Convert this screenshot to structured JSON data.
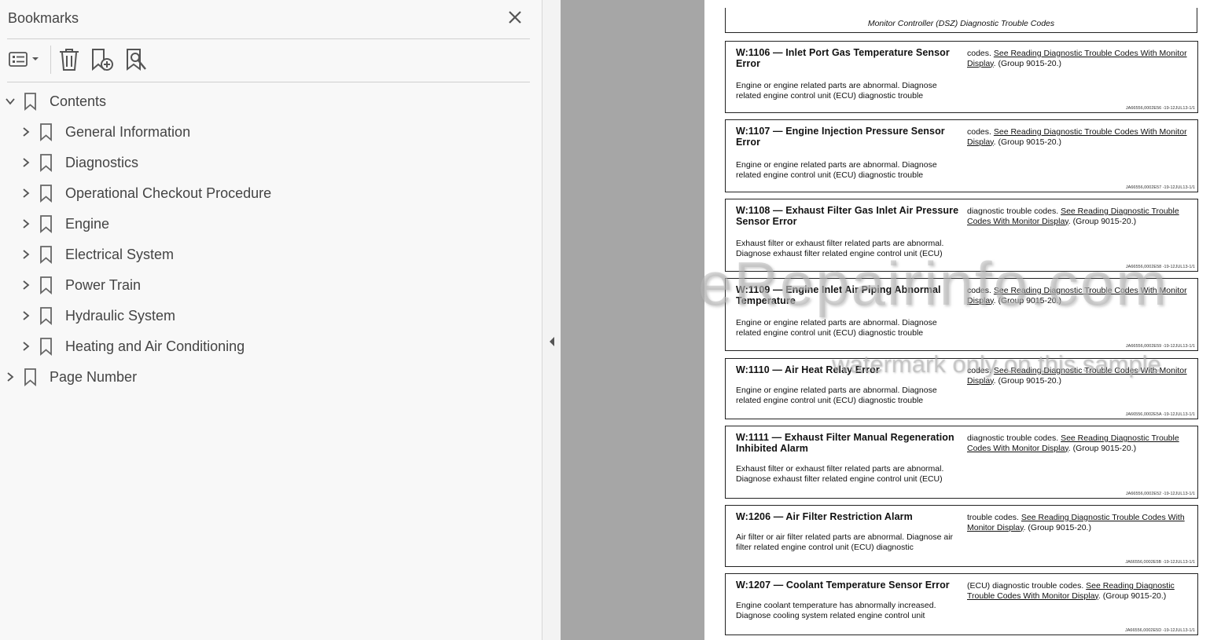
{
  "bookmarks_panel": {
    "title": "Bookmarks",
    "items": [
      {
        "label": "Contents",
        "level": 0,
        "expanded": true
      },
      {
        "label": "General Information",
        "level": 1,
        "expanded": false
      },
      {
        "label": "Diagnostics",
        "level": 1,
        "expanded": false
      },
      {
        "label": "Operational Checkout Procedure",
        "level": 1,
        "expanded": false
      },
      {
        "label": "Engine",
        "level": 1,
        "expanded": false
      },
      {
        "label": "Electrical System",
        "level": 1,
        "expanded": false
      },
      {
        "label": "Power Train",
        "level": 1,
        "expanded": false
      },
      {
        "label": "Hydraulic System",
        "level": 1,
        "expanded": false
      },
      {
        "label": "Heating and Air Conditioning",
        "level": 1,
        "expanded": false
      },
      {
        "label": "Page Number",
        "level": 0,
        "expanded": false
      }
    ]
  },
  "document": {
    "header": "Monitor Controller (DSZ) Diagnostic Trouble Codes",
    "entries": [
      {
        "title": "W:1106 — Inlet Port Gas Temperature Sensor Error",
        "desc": "Engine or engine related parts are abnormal. Diagnose related engine control unit (ECU) diagnostic trouble",
        "right_pre": "codes. ",
        "link": "See Reading Diagnostic Trouble Codes With Monitor Display",
        "right_post": ". (Group 9015-20.)",
        "ref": "JA66556,0002E56 -19-12JUL13-1/1"
      },
      {
        "title": "W:1107 — Engine Injection Pressure Sensor Error",
        "desc": "Engine or engine related parts are abnormal. Diagnose related engine control unit (ECU) diagnostic trouble",
        "right_pre": "codes. ",
        "link": "See Reading Diagnostic Trouble Codes With Monitor Display",
        "right_post": ". (Group 9015-20.)",
        "ref": "JA66556,0002E57 -19-12JUL13-1/1"
      },
      {
        "title": "W:1108 — Exhaust Filter Gas Inlet Air Pressure Sensor Error",
        "desc": "Exhaust filter or exhaust filter related parts are abnormal. Diagnose exhaust filter related engine control unit (ECU)",
        "right_pre": "diagnostic trouble codes. ",
        "link": "See Reading Diagnostic Trouble Codes With Monitor Display",
        "right_post": ". (Group 9015-20.)",
        "ref": "JA66556,0002E58 -19-12JUL13-1/1"
      },
      {
        "title": "W:1109 — Engine Inlet Air Piping Abnormal Temperature",
        "desc": "Engine or engine related parts are abnormal. Diagnose related engine control unit (ECU) diagnostic trouble",
        "right_pre": "codes. ",
        "link": "See Reading Diagnostic Trouble Codes With Monitor Display",
        "right_post": ". (Group 9015-20.)",
        "ref": "JA66556,0002E59 -19-12JUL13-1/1"
      },
      {
        "title": "W:1110 — Air Heat Relay Error",
        "desc": "Engine or engine related parts are abnormal. Diagnose related engine control unit (ECU) diagnostic trouble",
        "right_pre": "codes. ",
        "link": "See Reading Diagnostic Trouble Codes With Monitor Display",
        "right_post": ". (Group 9015-20.)",
        "ref": "JA66556,0002E5A -19-12JUL13-1/1"
      },
      {
        "title": "W:1111 — Exhaust Filter Manual Regeneration Inhibited Alarm",
        "desc": "Exhaust filter or exhaust filter related parts are abnormal. Diagnose exhaust filter related engine control unit (ECU)",
        "right_pre": "diagnostic trouble codes. ",
        "link": "See Reading Diagnostic Trouble Codes With Monitor Display",
        "right_post": ". (Group 9015-20.)",
        "ref": "JA66556,0002E52 -19-12JUL13-1/1"
      },
      {
        "title": "W:1206 — Air Filter Restriction Alarm",
        "desc": "Air filter or air filter related parts are abnormal. Diagnose air filter related engine control unit (ECU) diagnostic",
        "right_pre": "trouble codes. ",
        "link": "See Reading Diagnostic Trouble Codes With Monitor Display",
        "right_post": ". (Group 9015-20.)",
        "ref": "JA66556,0002E5B -19-12JUL13-1/1"
      },
      {
        "title": "W:1207 — Coolant Temperature Sensor Error",
        "desc": "Engine coolant temperature has abnormally increased. Diagnose cooling system related engine control unit",
        "right_pre": "(ECU) diagnostic trouble codes. ",
        "link": "See Reading Diagnostic Trouble Codes With Monitor Display",
        "right_post": ". (Group 9015-20.)",
        "ref": "JA66556,0002E5D -19-12JUL13-1/1"
      }
    ]
  },
  "watermark": {
    "main": "eRepairinfo.com",
    "sub": "watermark only on this sample"
  },
  "icons": [
    "close-icon",
    "options-icon",
    "delete-icon",
    "add-bookmark-icon",
    "find-bookmark-icon",
    "chevron-right-icon",
    "chevron-down-icon",
    "bookmark-icon",
    "collapse-panel-icon"
  ]
}
